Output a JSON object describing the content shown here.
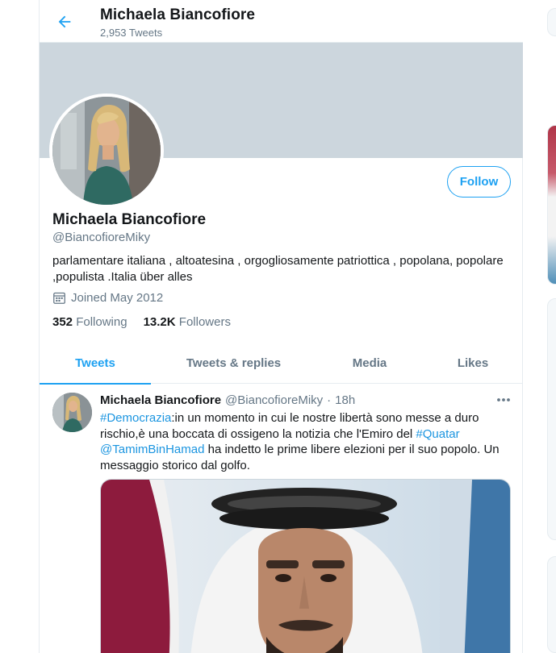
{
  "header": {
    "title": "Michaela Biancofiore",
    "tweet_count": "2,953 Tweets",
    "back_icon": "arrow-left-icon"
  },
  "profile": {
    "name": "Michaela Biancofiore",
    "handle": "@BiancofioreMiky",
    "bio": "parlamentare italiana , altoatesina , orgogliosamente patriottica , popolana, popolare ,populista .Italia über alles",
    "joined": "Joined May 2012",
    "joined_icon": "calendar-icon",
    "following_count": "352",
    "following_label": "Following",
    "followers_count": "13.2K",
    "followers_label": "Followers",
    "follow_button": "Follow"
  },
  "tabs": [
    {
      "label": "Tweets",
      "active": true
    },
    {
      "label": "Tweets & replies",
      "active": false
    },
    {
      "label": "Media",
      "active": false
    },
    {
      "label": "Likes",
      "active": false
    }
  ],
  "tweet": {
    "author_name": "Michaela Biancofiore",
    "author_handle": "@BiancofioreMiky",
    "separator": "·",
    "time": "18h",
    "more_icon": "more-horizontal-icon",
    "text_parts": [
      {
        "type": "link",
        "text": "#Democrazia"
      },
      {
        "type": "text",
        "text": ":in un momento in cui le nostre libertà sono messe a duro rischio,è una boccata di ossigeno la notizia che l'Emiro del "
      },
      {
        "type": "link",
        "text": "#Quatar"
      },
      {
        "type": "text",
        "text": " "
      },
      {
        "type": "link",
        "text": "@TamimBinHamad"
      },
      {
        "type": "text",
        "text": " ha indetto le prime libere elezioni per il suo popolo. Un messaggio storico dal golfo."
      }
    ]
  },
  "colors": {
    "accent": "#1da1f2",
    "link": "#1b95e0",
    "banner": "#ccd6dd",
    "secondary_text": "#657786"
  }
}
